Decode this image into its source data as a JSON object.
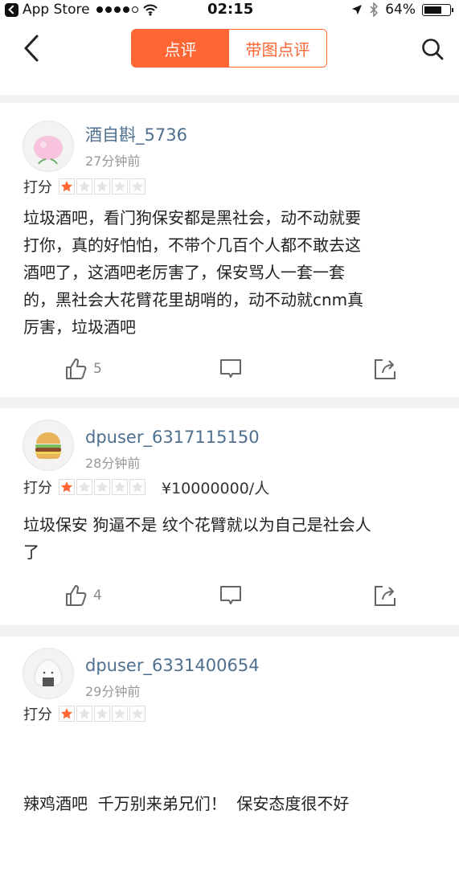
{
  "status_bar": {
    "back_app": "App Store",
    "time": "02:15",
    "battery": "64%"
  },
  "nav": {
    "tabs": [
      {
        "label": "点评",
        "active": true
      },
      {
        "label": "带图点评",
        "active": false
      }
    ],
    "accent_color": "#ff6633"
  },
  "reviews": [
    {
      "username": "酒自斟_5736",
      "time_ago": "27分钟前",
      "rating_label": "打分",
      "stars": 1,
      "price": "",
      "lines": [
        "垃圾酒吧，看门狗保安都是黑社会，动不动就要",
        "打你，真的好怕怕，不带个几百个人都不敢去这",
        "酒吧了，这酒吧老厉害了，保安骂人一套一套",
        "的，黑社会大花臂花里胡哨的，动不动就cnm真",
        "厉害，垃圾酒吧"
      ],
      "likes": "5",
      "avatar": "peach-avatar"
    },
    {
      "username": "dpuser_6317115150",
      "time_ago": "28分钟前",
      "rating_label": "打分",
      "stars": 1,
      "price": "¥10000000/人",
      "lines": [
        "垃圾保安 狗逼不是 纹个花臂就以为自己是社会人",
        "了"
      ],
      "likes": "4",
      "avatar": "burger-avatar"
    },
    {
      "username": "dpuser_6331400654",
      "time_ago": "29分钟前",
      "rating_label": "打分",
      "stars": 1,
      "price": "",
      "lines": [
        "辣鸡酒吧  千万别来弟兄们！  保安态度很不好"
      ],
      "likes": "",
      "avatar": "rice-ball-avatar"
    }
  ]
}
